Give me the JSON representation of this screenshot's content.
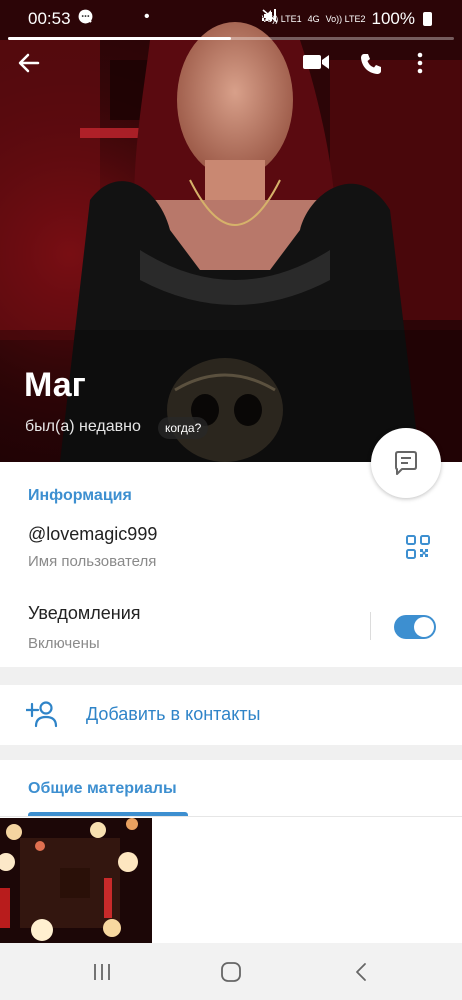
{
  "status_bar": {
    "time": "00:53",
    "left_icons": [
      "search-icon",
      "whatsapp-icon",
      "message-icon"
    ],
    "sim1_label": "Vo)) LTE1",
    "network": "4G",
    "sim2_label": "Vo)) LTE2",
    "battery": "100%"
  },
  "story_progress": 0.5,
  "toolbar": {
    "back": "arrow-left-icon",
    "video_call": "video-camera-icon",
    "call": "phone-icon",
    "menu": "more-vertical-icon"
  },
  "profile": {
    "name": "Маг",
    "status": "был(а) недавно",
    "when_label": "когда?"
  },
  "fab": "message-icon",
  "info": {
    "title": "Информация",
    "username": "@lovemagic999",
    "username_caption": "Имя пользователя",
    "notifications_label": "Уведомления",
    "notifications_state": "Включены",
    "notifications_on": true
  },
  "add_contact": {
    "label": "Добавить в контакты"
  },
  "shared_media": {
    "tab_label": "Общие материалы"
  },
  "colors": {
    "accent": "#3d8fd0",
    "hero_bg": "#3a0608"
  }
}
